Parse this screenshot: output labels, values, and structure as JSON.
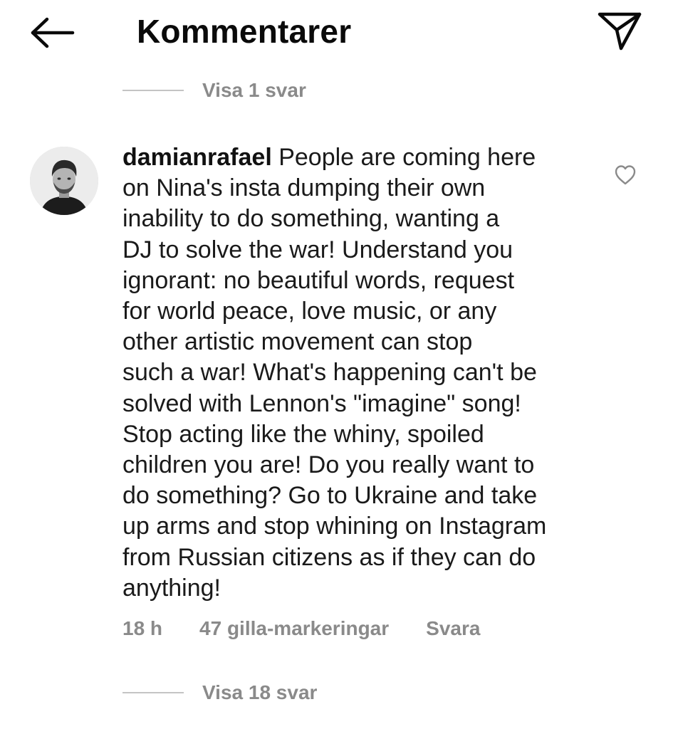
{
  "header": {
    "title": "Kommentarer",
    "back_icon": "arrow-left-icon",
    "send_icon": "paper-plane-icon"
  },
  "replies_top": {
    "label": "Visa 1 svar"
  },
  "comment": {
    "username": "damianrafael",
    "text_lines": [
      "People are coming here",
      "on Nina's insta dumping their own",
      "inability to do something, wanting a",
      "DJ to solve the war! Understand you",
      "ignorant: no beautiful words, request",
      "for world peace, love music, or any",
      "other artistic movement can stop",
      "such a war! What's happening can't be",
      "solved with Lennon's \"imagine\" song!",
      "Stop acting like the whiny, spoiled",
      "children you are! Do you really want to",
      "do something? Go to Ukraine and take",
      "up arms and stop whining on Instagram",
      "from Russian citizens as if they can do",
      "anything!"
    ],
    "time": "18 h",
    "likes": "47 gilla-markeringar",
    "reply": "Svara",
    "like_icon": "heart-outline-icon"
  },
  "replies_bottom": {
    "label": "Visa 18 svar"
  },
  "colors": {
    "text": "#111111",
    "secondary": "#8a8a8a",
    "divider": "#c4c4c4",
    "background": "#ffffff"
  }
}
